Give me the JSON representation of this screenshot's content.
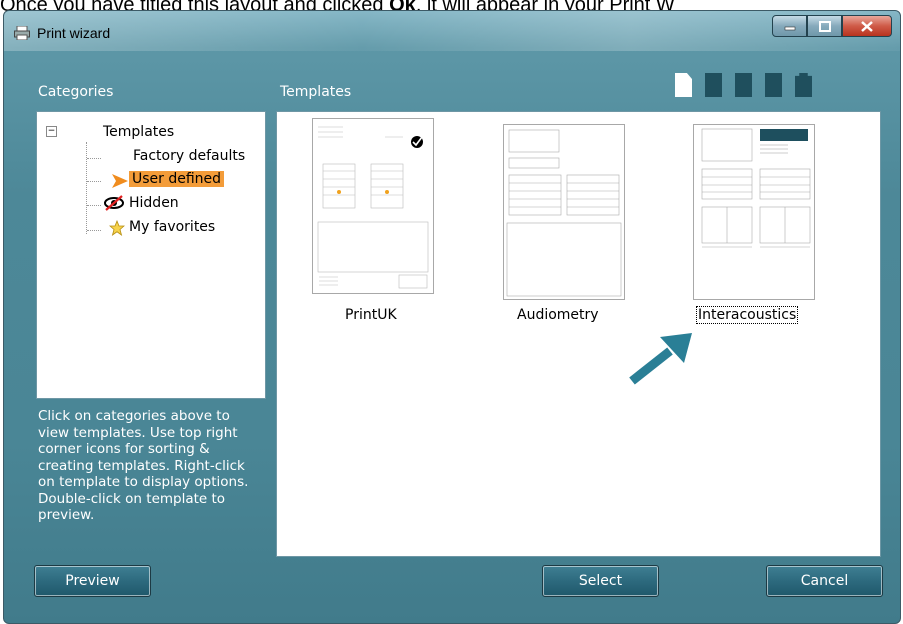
{
  "caption": {
    "prefix": "Once you have titled this layout and clicked ",
    "bold": "Ok",
    "suffix": ", it will appear in your Print W"
  },
  "window": {
    "title": "Print wizard",
    "title_icon": "printer-icon",
    "controls": [
      "minimize-icon",
      "maximize-icon",
      "close-icon"
    ]
  },
  "categories": {
    "label": "Categories",
    "tree": {
      "root": "Templates",
      "children": [
        {
          "label": "Factory defaults",
          "icon": ""
        },
        {
          "label": "User defined",
          "icon": "orange-arrow-icon",
          "selected": true
        },
        {
          "label": "Hidden",
          "icon": "hidden-eye-icon"
        },
        {
          "label": "My favorites",
          "icon": "star-icon"
        }
      ]
    },
    "help_text": "Click on categories above to view templates. Use top right corner icons for sorting & creating templates. Right-click on template to display options. Double-click on template to preview."
  },
  "templates": {
    "label": "Templates",
    "toolbar_icons": [
      "new-template-icon",
      "sort-icon",
      "sort-icon",
      "sort-icon",
      "folder-icon"
    ],
    "items": [
      {
        "name": "PrintUK"
      },
      {
        "name": "Audiometry"
      },
      {
        "name": "Interacoustics",
        "focused": true
      }
    ]
  },
  "buttons": {
    "preview": "Preview",
    "select": "Select",
    "cancel": "Cancel"
  },
  "annotation": {
    "icon": "pointer-arrow-icon",
    "color": "#2a7f96"
  }
}
